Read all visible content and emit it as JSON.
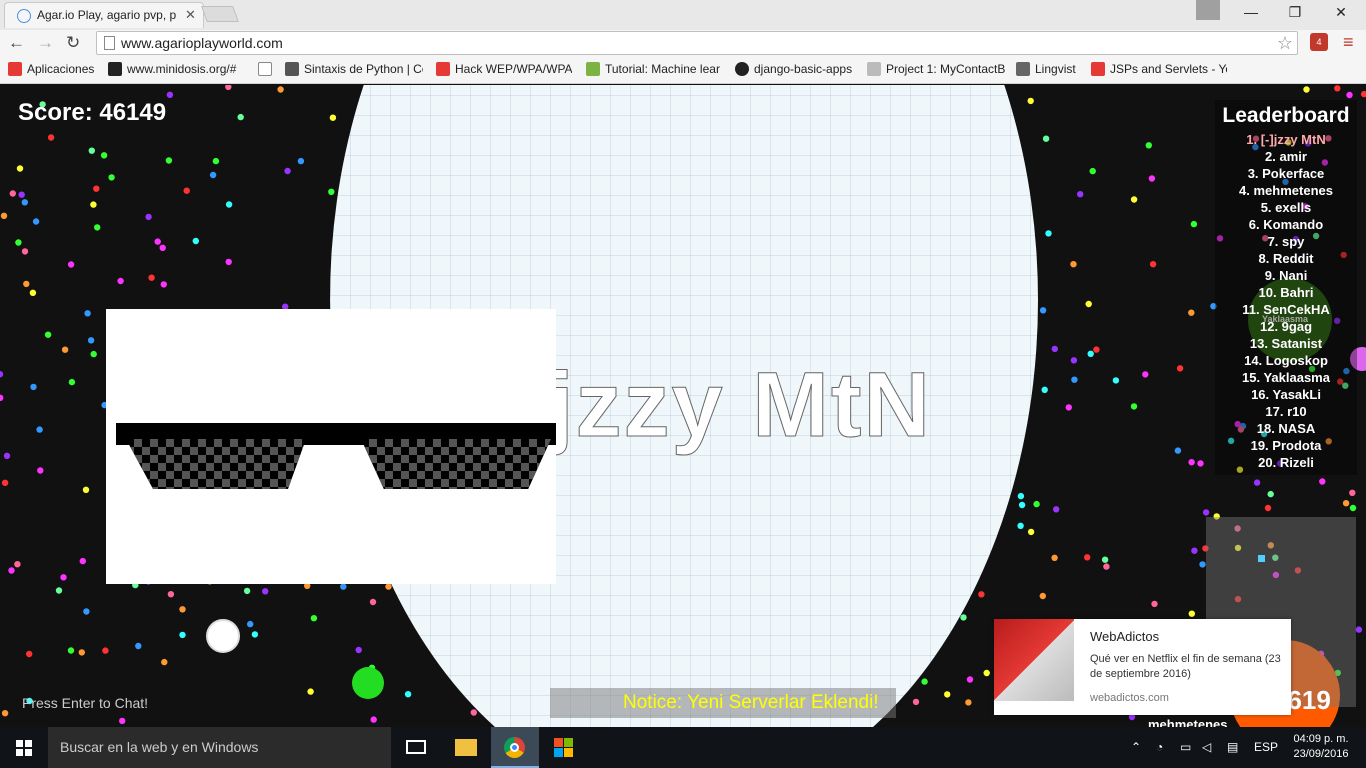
{
  "browser": {
    "tab_title": "Agar.io Play, agario pvp, p",
    "url": "www.agarioplayworld.com",
    "window_controls": {
      "minimize": "—",
      "restore": "❐",
      "close": "✕"
    },
    "extension_badge": "4"
  },
  "bookmarks": [
    {
      "label": "Aplicaciones",
      "icon_color": "#e53935"
    },
    {
      "label": "www.minidosis.org/#",
      "icon_color": "#222222"
    },
    {
      "label": "",
      "icon_color": "#ffffff"
    },
    {
      "label": "Sintaxis de Python | Co",
      "icon_color": "#555555"
    },
    {
      "label": "Hack WEP/WPA/WPA",
      "icon_color": "#e53935"
    },
    {
      "label": "Tutorial: Machine lear",
      "icon_color": "#7cb342"
    },
    {
      "label": "django-basic-apps",
      "icon_color": "#222222"
    },
    {
      "label": "Project 1: MyContactB",
      "icon_color": "#bbbbbb"
    },
    {
      "label": "Lingvist",
      "icon_color": "#666666"
    },
    {
      "label": "JSPs and Servlets - You",
      "icon_color": "#e53935"
    }
  ],
  "game": {
    "score_label": "Score: 46149",
    "player_name": "jzzy MtN",
    "chat_hint": "Press Enter to Chat!",
    "notice": "Notice: Yeni Serverlar Eklendi!",
    "other_score": "2619",
    "other_player": "mehmetenes",
    "small_cell_label": "Yaklaasma"
  },
  "leaderboard": {
    "title": "Leaderboard",
    "entries": [
      "1. [-]jzzy MtN",
      "2. amir",
      "3. Pokerface",
      "4. mehmetenes",
      "5. exells",
      "6. Komando",
      "7. spy",
      "8. Reddit",
      "9. Nani",
      "10. Bahri",
      "11. SenCekHA",
      "12. 9gag",
      "13. Satanist",
      "14. Logoskop",
      "15. Yaklaasma",
      "16. YasakLi",
      "17. r10",
      "18. NASA",
      "19. Prodota",
      "20. Rizeli"
    ],
    "highlight_color": "#ffaaaa"
  },
  "notification": {
    "site": "WebAdictos",
    "body": "Qué ver en Netflix el fin de semana (23 de septiembre 2016)",
    "domain": "webadictos.com"
  },
  "taskbar": {
    "search_placeholder": "Buscar en la web y en Windows",
    "language": "ESP",
    "time": "04:09 p. m.",
    "date": "23/09/2016"
  },
  "colors": {
    "game_background": "#111111",
    "player_cell": "#f0f7fb",
    "notice_text": "#ffff00",
    "taskbar": "#101418"
  }
}
